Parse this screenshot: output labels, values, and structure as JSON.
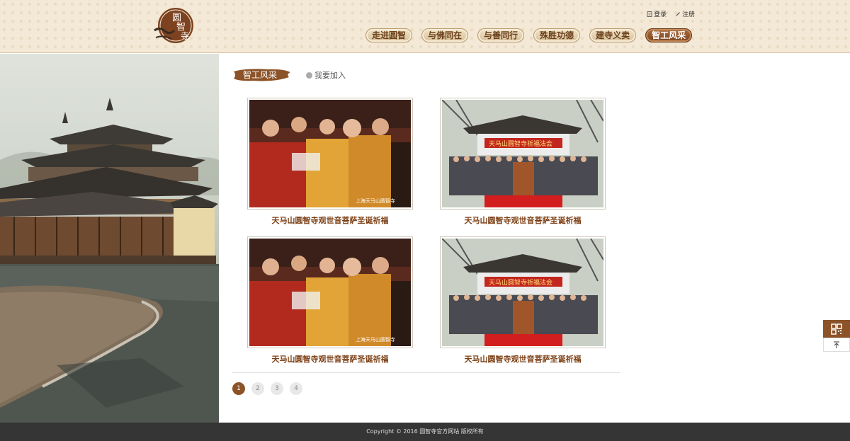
{
  "header": {
    "logo_alt": "圆智寺",
    "login_label": "登录",
    "register_label": "注册",
    "nav": [
      {
        "label": "走进圆智",
        "active": false
      },
      {
        "label": "与佛同在",
        "active": false
      },
      {
        "label": "与善同行",
        "active": false
      },
      {
        "label": "殊胜功德",
        "active": false
      },
      {
        "label": "建寺义卖",
        "active": false
      },
      {
        "label": "智工风采",
        "active": true
      }
    ]
  },
  "main": {
    "tab_active": "智工风采",
    "tab_join": "我要加入",
    "items": [
      {
        "caption": "天马山圆智寺观世音菩萨圣诞祈福",
        "photo": "monks-crowd"
      },
      {
        "caption": "天马山圆智寺观世音菩萨圣诞祈福",
        "photo": "group-gate"
      },
      {
        "caption": "天马山圆智寺观世音菩萨圣诞祈福",
        "photo": "monks-crowd"
      },
      {
        "caption": "天马山圆智寺观世音菩萨圣诞祈福",
        "photo": "group-gate"
      }
    ],
    "pages": [
      "1",
      "2",
      "3",
      "4"
    ],
    "current_page": "1"
  },
  "footer": {
    "copyright": "Copyright © 2016 圆智寺官方网站 版权所有"
  },
  "colors": {
    "brand_brown": "#8c5328",
    "header_bg": "#f4e9d6",
    "caption": "#7a3d12",
    "footer_bg": "#353535"
  },
  "icons": [
    "logo-seal-icon",
    "login-icon",
    "register-icon",
    "qrcode-icon",
    "back-to-top-icon"
  ]
}
